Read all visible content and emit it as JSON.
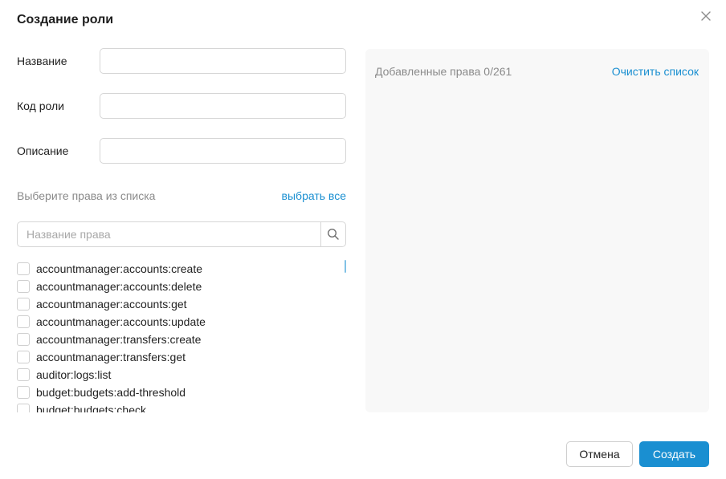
{
  "dialog": {
    "title": "Создание роли"
  },
  "form": {
    "name_label": "Название",
    "name_value": "",
    "code_label": "Код роли",
    "code_value": "",
    "description_label": "Описание",
    "description_value": ""
  },
  "rights": {
    "hint": "Выберите права из списка",
    "select_all": "выбрать все",
    "search_placeholder": "Название права",
    "items": [
      "accountmanager:accounts:create",
      "accountmanager:accounts:delete",
      "accountmanager:accounts:get",
      "accountmanager:accounts:update",
      "accountmanager:transfers:create",
      "accountmanager:transfers:get",
      "auditor:logs:list",
      "budget:budgets:add-threshold",
      "budget:budgets:check"
    ]
  },
  "added": {
    "count_label": "Добавленные права 0/261",
    "clear_label": "Очистить список"
  },
  "actions": {
    "cancel": "Отмена",
    "create": "Создать"
  },
  "colors": {
    "accent": "#1a8fd1",
    "panel_bg": "#f8f8f8",
    "border": "#d6d6d6"
  },
  "icons": {
    "close": "close-icon",
    "search": "search-icon"
  }
}
